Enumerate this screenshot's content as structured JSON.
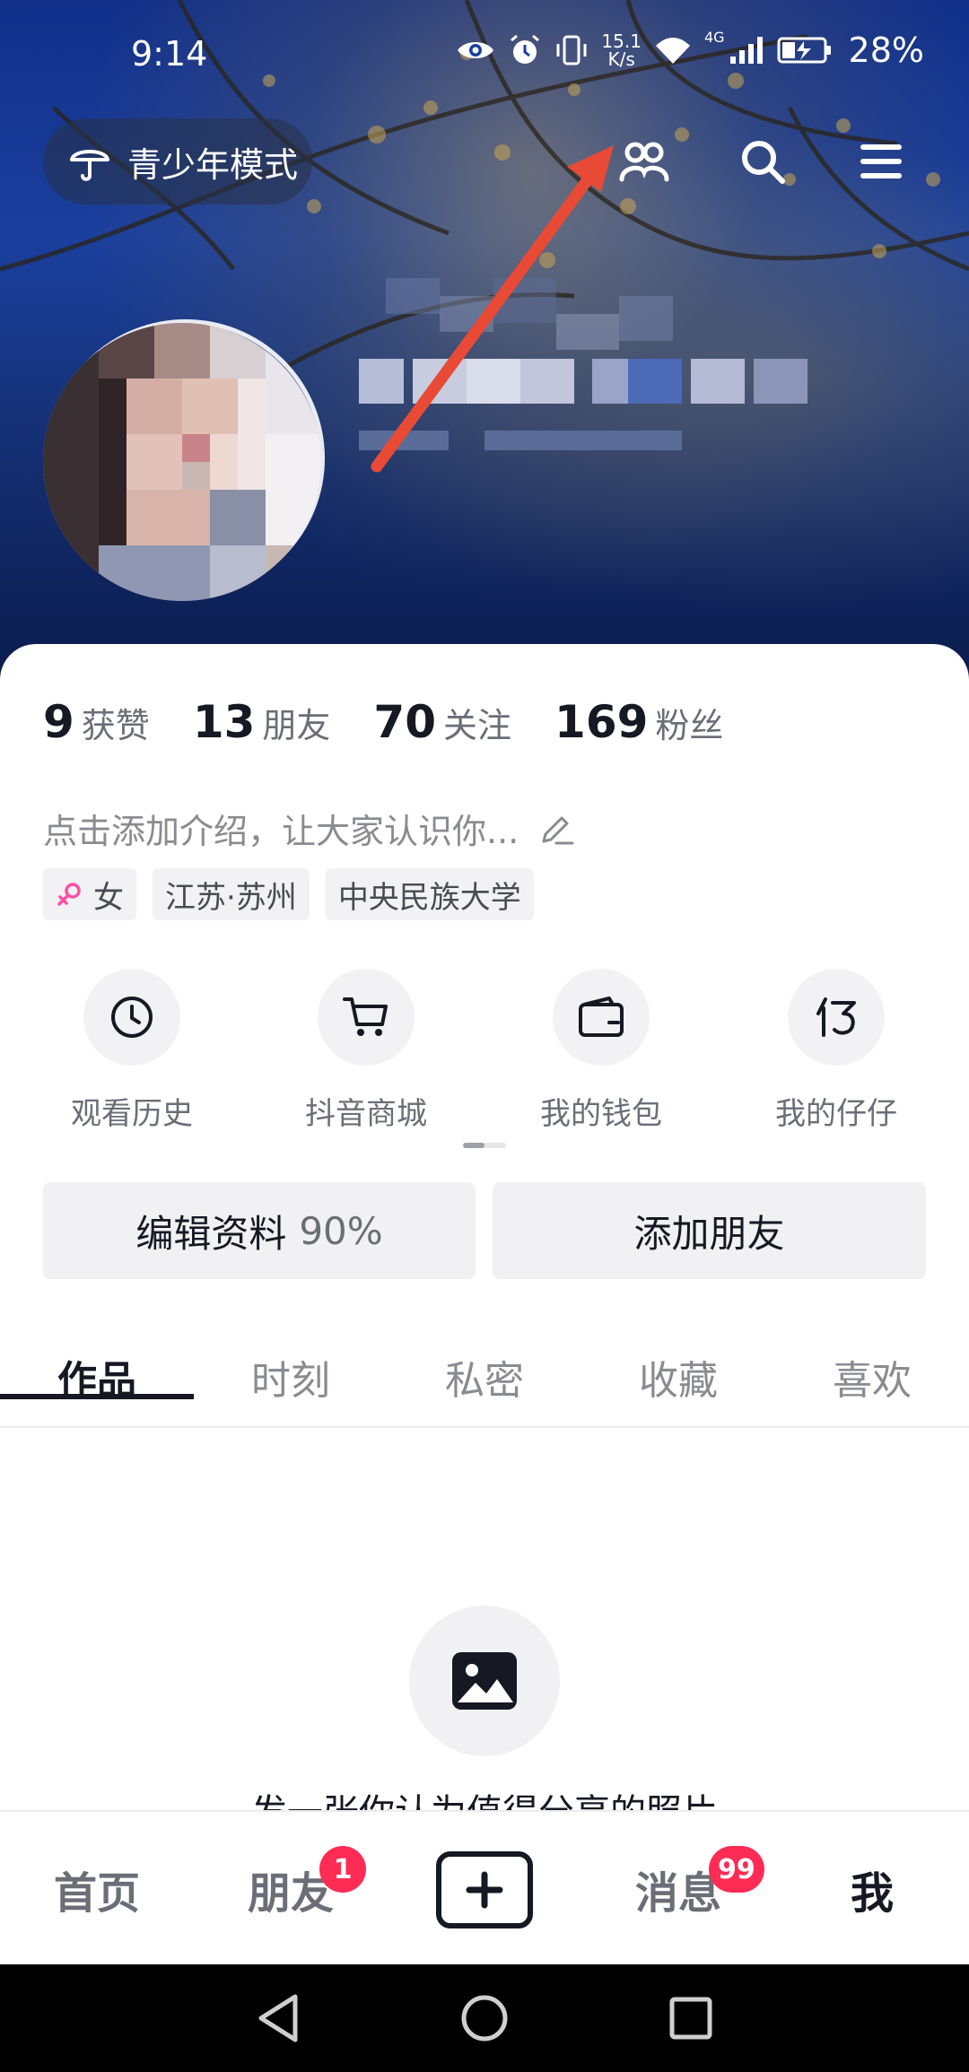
{
  "status_bar": {
    "time": "9:14",
    "net_speed_value": "15.1",
    "net_speed_unit": "K/s",
    "network": "4G",
    "battery": "28%"
  },
  "header": {
    "teen_mode_label": "青少年模式",
    "icons": [
      "friends-icon",
      "search-icon",
      "menu-icon"
    ]
  },
  "stats": [
    {
      "value": "9",
      "label": "获赞"
    },
    {
      "value": "13",
      "label": "朋友"
    },
    {
      "value": "70",
      "label": "关注"
    },
    {
      "value": "169",
      "label": "粉丝"
    }
  ],
  "profile": {
    "bio_placeholder": "点击添加介绍，让大家认识你...",
    "tags": {
      "gender": "女",
      "location": "江苏·苏州",
      "school": "中央民族大学"
    }
  },
  "shortcuts": [
    {
      "label": "观看历史",
      "icon": "clock-icon"
    },
    {
      "label": "抖音商城",
      "icon": "cart-icon"
    },
    {
      "label": "我的钱包",
      "icon": "wallet-icon"
    },
    {
      "label": "我的仔仔",
      "icon": "zaizai-icon"
    }
  ],
  "actions": {
    "edit_profile_label": "编辑资料",
    "edit_profile_percent": "90%",
    "add_friend_label": "添加朋友"
  },
  "tabs": [
    "作品",
    "时刻",
    "私密",
    "收藏",
    "喜欢"
  ],
  "empty_state": {
    "text": "发一张你认为值得分享的照片"
  },
  "bottom_nav": {
    "home": "首页",
    "friends": "朋友",
    "friends_badge": "1",
    "messages": "消息",
    "messages_badge": "99",
    "me": "我"
  },
  "colors": {
    "accent_red": "#fe2c55",
    "text_primary": "#161823",
    "text_secondary": "#8a8b91",
    "gender_female": "#ff4fa6"
  }
}
